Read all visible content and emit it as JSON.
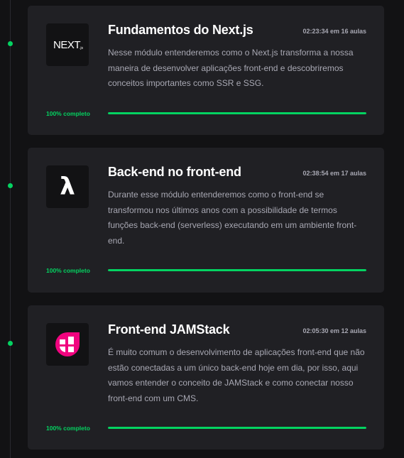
{
  "modules": [
    {
      "logo_icon": "nextjs-logo",
      "logo_text": "NEXT",
      "title": "Fundamentos do Next.js",
      "duration": "02:23:34 em 16 aulas",
      "description": "Nesse módulo entenderemos como o Next.js transforma a nossa maneira de desenvolver aplicações front-end e descobriremos conceitos importantes como SSR e SSG.",
      "progress_label": "100% completo",
      "progress": 1.0
    },
    {
      "logo_icon": "lambda-logo",
      "logo_text": "λ",
      "title": "Back-end no front-end",
      "duration": "02:38:54 em 17 aulas",
      "description": "Durante esse módulo entenderemos como o front-end se transformou nos últimos anos com a possibilidade de termos funções back-end (serverless) executando em um ambiente front-end.",
      "progress_label": "100% completo",
      "progress": 1.0
    },
    {
      "logo_icon": "jamstack-logo",
      "logo_text": "",
      "title": "Front-end JAMStack",
      "duration": "02:05:30 em 12 aulas",
      "description": "É muito comum o desenvolvimento de aplicações front-end que não estão conectadas a um único back-end hoje em dia, por isso, aqui vamos entender o conceito de JAMStack e como conectar nosso front-end com um CMS.",
      "progress_label": "100% completo",
      "progress": 1.0
    }
  ],
  "colors": {
    "accent": "#04d361",
    "card_bg": "#202024",
    "page_bg": "#121214",
    "jamstack_pink": "#f0047f"
  }
}
